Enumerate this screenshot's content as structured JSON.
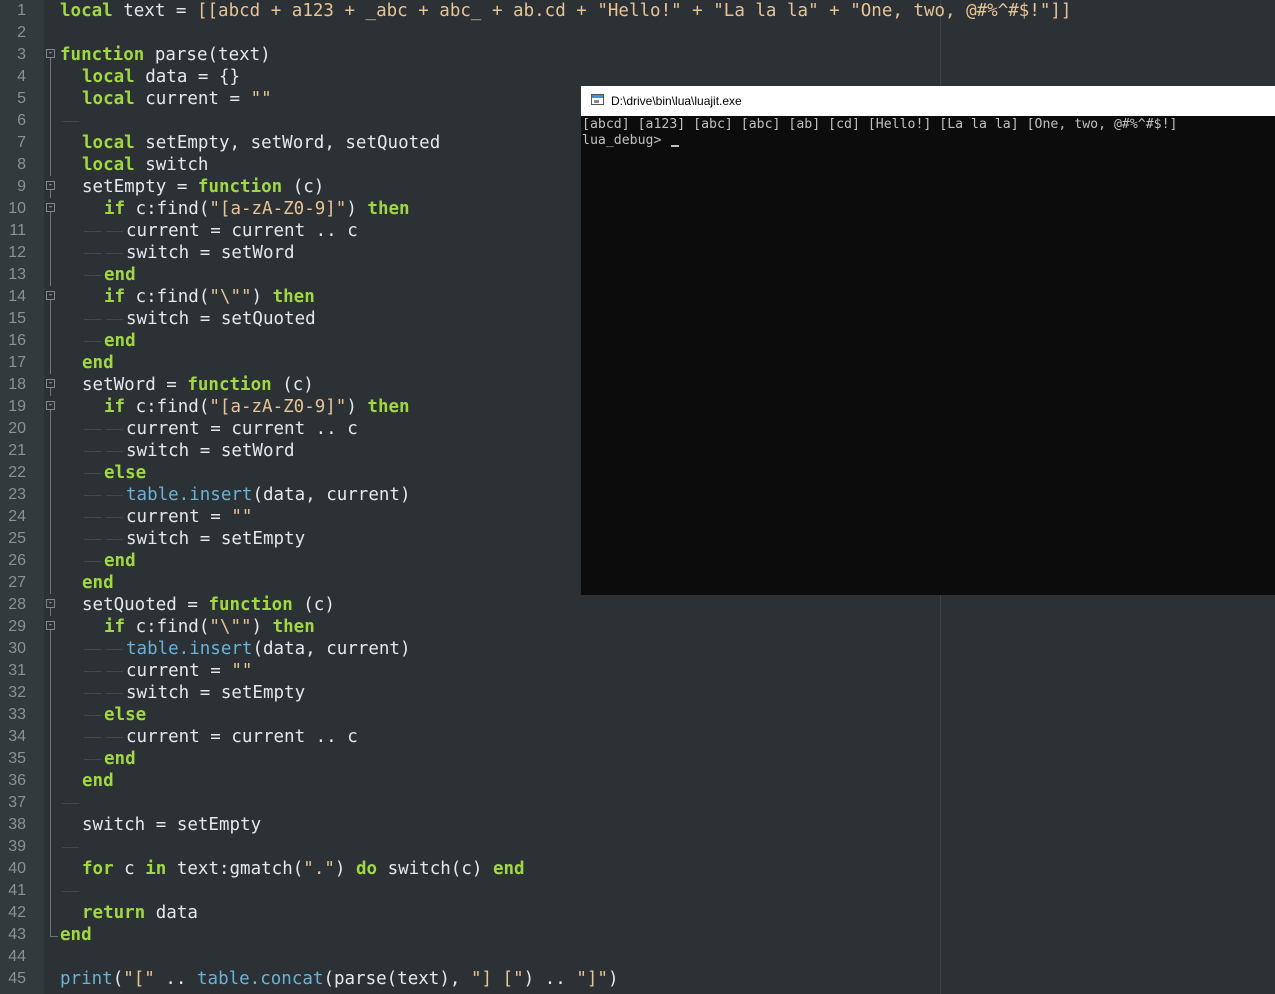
{
  "editor": {
    "lines": [
      {
        "n": "1",
        "i": 0,
        "fold": "line",
        "t": [
          [
            "kw",
            "local"
          ],
          [
            "",
            "text = "
          ],
          [
            "str",
            "[[abcd + a123 + _abc + abc_ + ab.cd + \"Hello!\" + \"La la la\" + \"One, two, @#%^#$!\"]]"
          ]
        ]
      },
      {
        "n": "2",
        "i": 0,
        "fold": "line",
        "t": []
      },
      {
        "n": "3",
        "i": 0,
        "fold": "box",
        "t": [
          [
            "kw",
            "function"
          ],
          [
            "",
            "parse(text)"
          ]
        ]
      },
      {
        "n": "4",
        "i": 1,
        "fold": "line",
        "t": [
          [
            "kw",
            "local"
          ],
          [
            "",
            "data = {}"
          ]
        ]
      },
      {
        "n": "5",
        "i": 1,
        "fold": "line",
        "t": [
          [
            "kw",
            "local"
          ],
          [
            "",
            "current = "
          ],
          [
            "str",
            "\"\""
          ]
        ]
      },
      {
        "n": "6",
        "i": 0,
        "fold": "line",
        "tab": 1,
        "t": []
      },
      {
        "n": "7",
        "i": 1,
        "fold": "line",
        "t": [
          [
            "kw",
            "local"
          ],
          [
            "",
            "setEmpty, setWord, setQuoted"
          ]
        ]
      },
      {
        "n": "8",
        "i": 1,
        "fold": "line",
        "t": [
          [
            "kw",
            "local"
          ],
          [
            "",
            "switch"
          ]
        ]
      },
      {
        "n": "9",
        "i": 1,
        "fold": "box",
        "t": [
          [
            "",
            "setEmpty = "
          ],
          [
            "kw",
            "function"
          ],
          [
            "",
            "(c)"
          ]
        ]
      },
      {
        "n": "10",
        "i": 2,
        "fold": "box",
        "t": [
          [
            "kw",
            "if"
          ],
          [
            "",
            "c:find("
          ],
          [
            "str",
            "\"[a-zA-Z0-9]\""
          ],
          [
            "",
            ") "
          ],
          [
            "kw",
            "then"
          ]
        ]
      },
      {
        "n": "11",
        "i": 3,
        "fold": "line",
        "tab": 1,
        "t": [
          [
            "",
            "current = current .. c"
          ]
        ]
      },
      {
        "n": "12",
        "i": 3,
        "fold": "line",
        "tab": 1,
        "t": [
          [
            "",
            "switch = setWord"
          ]
        ]
      },
      {
        "n": "13",
        "i": 2,
        "fold": "line",
        "tab": 1,
        "t": [
          [
            "kw",
            "end"
          ]
        ]
      },
      {
        "n": "14",
        "i": 2,
        "fold": "box",
        "t": [
          [
            "kw",
            "if"
          ],
          [
            "",
            "c:find("
          ],
          [
            "str",
            "\"\\\"\""
          ],
          [
            "",
            ") "
          ],
          [
            "kw",
            "then"
          ]
        ]
      },
      {
        "n": "15",
        "i": 3,
        "fold": "line",
        "tab": 1,
        "t": [
          [
            "",
            "switch = setQuoted"
          ]
        ]
      },
      {
        "n": "16",
        "i": 2,
        "fold": "line",
        "tab": 1,
        "t": [
          [
            "kw",
            "end"
          ]
        ]
      },
      {
        "n": "17",
        "i": 1,
        "fold": "line",
        "t": [
          [
            "kw",
            "end"
          ]
        ]
      },
      {
        "n": "18",
        "i": 1,
        "fold": "box",
        "t": [
          [
            "",
            "setWord = "
          ],
          [
            "kw",
            "function"
          ],
          [
            "",
            "(c)"
          ]
        ]
      },
      {
        "n": "19",
        "i": 2,
        "fold": "box",
        "t": [
          [
            "kw",
            "if"
          ],
          [
            "",
            "c:find("
          ],
          [
            "str",
            "\"[a-zA-Z0-9]\""
          ],
          [
            "",
            ") "
          ],
          [
            "kw",
            "then"
          ]
        ]
      },
      {
        "n": "20",
        "i": 3,
        "fold": "line",
        "tab": 1,
        "t": [
          [
            "",
            "current = current .. c"
          ]
        ]
      },
      {
        "n": "21",
        "i": 3,
        "fold": "line",
        "tab": 1,
        "t": [
          [
            "",
            "switch = setWord"
          ]
        ]
      },
      {
        "n": "22",
        "i": 2,
        "fold": "line",
        "tab": 1,
        "t": [
          [
            "kw",
            "else"
          ]
        ]
      },
      {
        "n": "23",
        "i": 3,
        "fold": "line",
        "tab": 1,
        "t": [
          [
            "lib",
            "table.insert"
          ],
          [
            "",
            "(data, current)"
          ]
        ]
      },
      {
        "n": "24",
        "i": 3,
        "fold": "line",
        "tab": 1,
        "t": [
          [
            "",
            "current = "
          ],
          [
            "str",
            "\"\""
          ]
        ]
      },
      {
        "n": "25",
        "i": 3,
        "fold": "line",
        "tab": 1,
        "t": [
          [
            "",
            "switch = setEmpty"
          ]
        ]
      },
      {
        "n": "26",
        "i": 2,
        "fold": "line",
        "tab": 1,
        "t": [
          [
            "kw",
            "end"
          ]
        ]
      },
      {
        "n": "27",
        "i": 1,
        "fold": "line",
        "t": [
          [
            "kw",
            "end"
          ]
        ]
      },
      {
        "n": "28",
        "i": 1,
        "fold": "box",
        "t": [
          [
            "",
            "setQuoted = "
          ],
          [
            "kw",
            "function"
          ],
          [
            "",
            "(c)"
          ]
        ]
      },
      {
        "n": "29",
        "i": 2,
        "fold": "box",
        "t": [
          [
            "kw",
            "if"
          ],
          [
            "",
            "c:find("
          ],
          [
            "str",
            "\"\\\"\""
          ],
          [
            "",
            ") "
          ],
          [
            "kw",
            "then"
          ]
        ]
      },
      {
        "n": "30",
        "i": 3,
        "fold": "line",
        "tab": 1,
        "t": [
          [
            "lib",
            "table.insert"
          ],
          [
            "",
            "(data, current)"
          ]
        ]
      },
      {
        "n": "31",
        "i": 3,
        "fold": "line",
        "tab": 1,
        "t": [
          [
            "",
            "current = "
          ],
          [
            "str",
            "\"\""
          ]
        ]
      },
      {
        "n": "32",
        "i": 3,
        "fold": "line",
        "tab": 1,
        "t": [
          [
            "",
            "switch = setEmpty"
          ]
        ]
      },
      {
        "n": "33",
        "i": 2,
        "fold": "line",
        "tab": 1,
        "t": [
          [
            "kw",
            "else"
          ]
        ]
      },
      {
        "n": "34",
        "i": 3,
        "fold": "line",
        "tab": 1,
        "t": [
          [
            "",
            "current = current .. c"
          ]
        ]
      },
      {
        "n": "35",
        "i": 2,
        "fold": "line",
        "tab": 1,
        "t": [
          [
            "kw",
            "end"
          ]
        ]
      },
      {
        "n": "36",
        "i": 1,
        "fold": "line",
        "t": [
          [
            "kw",
            "end"
          ]
        ]
      },
      {
        "n": "37",
        "i": 0,
        "fold": "line",
        "tab": 1,
        "t": []
      },
      {
        "n": "38",
        "i": 1,
        "fold": "line",
        "t": [
          [
            "",
            "switch = setEmpty"
          ]
        ]
      },
      {
        "n": "39",
        "i": 0,
        "fold": "line",
        "tab": 1,
        "t": []
      },
      {
        "n": "40",
        "i": 1,
        "fold": "line",
        "t": [
          [
            "kw",
            "for"
          ],
          [
            "",
            "c "
          ],
          [
            "kw",
            "in"
          ],
          [
            "",
            "text:gmatch("
          ],
          [
            "str",
            "\".\""
          ],
          [
            "",
            ") "
          ],
          [
            "kw",
            "do"
          ],
          [
            "",
            "switch(c) "
          ],
          [
            "kw",
            "end"
          ]
        ]
      },
      {
        "n": "41",
        "i": 0,
        "fold": "line",
        "tab": 1,
        "t": []
      },
      {
        "n": "42",
        "i": 1,
        "fold": "line",
        "t": [
          [
            "kw",
            "return"
          ],
          [
            "",
            "data"
          ]
        ]
      },
      {
        "n": "43",
        "i": 0,
        "fold": "end",
        "t": [
          [
            "kw",
            "end"
          ]
        ]
      },
      {
        "n": "44",
        "i": 0,
        "fold": "none",
        "t": []
      },
      {
        "n": "45",
        "i": 0,
        "fold": "none",
        "t": [
          [
            "lib",
            "print"
          ],
          [
            "",
            "("
          ],
          [
            "str",
            "\"[\""
          ],
          [
            "",
            " .. "
          ],
          [
            "lib",
            "table.concat"
          ],
          [
            "",
            "(parse(text), "
          ],
          [
            "str",
            "\"] [\""
          ],
          [
            "",
            ") .. "
          ],
          [
            "str",
            "\"]\""
          ],
          [
            "",
            ")"
          ]
        ]
      }
    ]
  },
  "console": {
    "title": "D:\\drive\\bin\\lua\\luajit.exe",
    "output_line": "[abcd] [a123] [abc] [abc] [ab] [cd] [Hello!] [La la la] [One, two, @#%^#$!]",
    "prompt": "lua_debug> "
  },
  "icons": {
    "console_window": "console-window-icon"
  }
}
